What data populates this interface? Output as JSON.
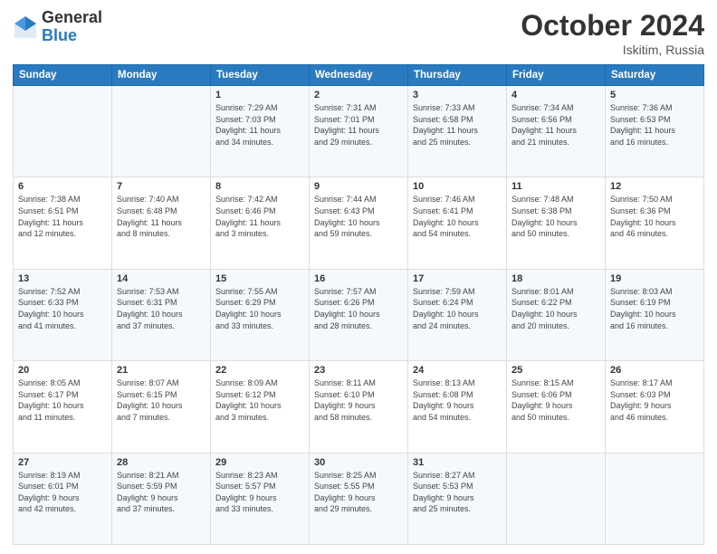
{
  "header": {
    "logo_general": "General",
    "logo_blue": "Blue",
    "title": "October 2024",
    "location": "Iskitim, Russia"
  },
  "days_of_week": [
    "Sunday",
    "Monday",
    "Tuesday",
    "Wednesday",
    "Thursday",
    "Friday",
    "Saturday"
  ],
  "weeks": [
    [
      {
        "day": "",
        "info": ""
      },
      {
        "day": "",
        "info": ""
      },
      {
        "day": "1",
        "info": "Sunrise: 7:29 AM\nSunset: 7:03 PM\nDaylight: 11 hours\nand 34 minutes."
      },
      {
        "day": "2",
        "info": "Sunrise: 7:31 AM\nSunset: 7:01 PM\nDaylight: 11 hours\nand 29 minutes."
      },
      {
        "day": "3",
        "info": "Sunrise: 7:33 AM\nSunset: 6:58 PM\nDaylight: 11 hours\nand 25 minutes."
      },
      {
        "day": "4",
        "info": "Sunrise: 7:34 AM\nSunset: 6:56 PM\nDaylight: 11 hours\nand 21 minutes."
      },
      {
        "day": "5",
        "info": "Sunrise: 7:36 AM\nSunset: 6:53 PM\nDaylight: 11 hours\nand 16 minutes."
      }
    ],
    [
      {
        "day": "6",
        "info": "Sunrise: 7:38 AM\nSunset: 6:51 PM\nDaylight: 11 hours\nand 12 minutes."
      },
      {
        "day": "7",
        "info": "Sunrise: 7:40 AM\nSunset: 6:48 PM\nDaylight: 11 hours\nand 8 minutes."
      },
      {
        "day": "8",
        "info": "Sunrise: 7:42 AM\nSunset: 6:46 PM\nDaylight: 11 hours\nand 3 minutes."
      },
      {
        "day": "9",
        "info": "Sunrise: 7:44 AM\nSunset: 6:43 PM\nDaylight: 10 hours\nand 59 minutes."
      },
      {
        "day": "10",
        "info": "Sunrise: 7:46 AM\nSunset: 6:41 PM\nDaylight: 10 hours\nand 54 minutes."
      },
      {
        "day": "11",
        "info": "Sunrise: 7:48 AM\nSunset: 6:38 PM\nDaylight: 10 hours\nand 50 minutes."
      },
      {
        "day": "12",
        "info": "Sunrise: 7:50 AM\nSunset: 6:36 PM\nDaylight: 10 hours\nand 46 minutes."
      }
    ],
    [
      {
        "day": "13",
        "info": "Sunrise: 7:52 AM\nSunset: 6:33 PM\nDaylight: 10 hours\nand 41 minutes."
      },
      {
        "day": "14",
        "info": "Sunrise: 7:53 AM\nSunset: 6:31 PM\nDaylight: 10 hours\nand 37 minutes."
      },
      {
        "day": "15",
        "info": "Sunrise: 7:55 AM\nSunset: 6:29 PM\nDaylight: 10 hours\nand 33 minutes."
      },
      {
        "day": "16",
        "info": "Sunrise: 7:57 AM\nSunset: 6:26 PM\nDaylight: 10 hours\nand 28 minutes."
      },
      {
        "day": "17",
        "info": "Sunrise: 7:59 AM\nSunset: 6:24 PM\nDaylight: 10 hours\nand 24 minutes."
      },
      {
        "day": "18",
        "info": "Sunrise: 8:01 AM\nSunset: 6:22 PM\nDaylight: 10 hours\nand 20 minutes."
      },
      {
        "day": "19",
        "info": "Sunrise: 8:03 AM\nSunset: 6:19 PM\nDaylight: 10 hours\nand 16 minutes."
      }
    ],
    [
      {
        "day": "20",
        "info": "Sunrise: 8:05 AM\nSunset: 6:17 PM\nDaylight: 10 hours\nand 11 minutes."
      },
      {
        "day": "21",
        "info": "Sunrise: 8:07 AM\nSunset: 6:15 PM\nDaylight: 10 hours\nand 7 minutes."
      },
      {
        "day": "22",
        "info": "Sunrise: 8:09 AM\nSunset: 6:12 PM\nDaylight: 10 hours\nand 3 minutes."
      },
      {
        "day": "23",
        "info": "Sunrise: 8:11 AM\nSunset: 6:10 PM\nDaylight: 9 hours\nand 58 minutes."
      },
      {
        "day": "24",
        "info": "Sunrise: 8:13 AM\nSunset: 6:08 PM\nDaylight: 9 hours\nand 54 minutes."
      },
      {
        "day": "25",
        "info": "Sunrise: 8:15 AM\nSunset: 6:06 PM\nDaylight: 9 hours\nand 50 minutes."
      },
      {
        "day": "26",
        "info": "Sunrise: 8:17 AM\nSunset: 6:03 PM\nDaylight: 9 hours\nand 46 minutes."
      }
    ],
    [
      {
        "day": "27",
        "info": "Sunrise: 8:19 AM\nSunset: 6:01 PM\nDaylight: 9 hours\nand 42 minutes."
      },
      {
        "day": "28",
        "info": "Sunrise: 8:21 AM\nSunset: 5:59 PM\nDaylight: 9 hours\nand 37 minutes."
      },
      {
        "day": "29",
        "info": "Sunrise: 8:23 AM\nSunset: 5:57 PM\nDaylight: 9 hours\nand 33 minutes."
      },
      {
        "day": "30",
        "info": "Sunrise: 8:25 AM\nSunset: 5:55 PM\nDaylight: 9 hours\nand 29 minutes."
      },
      {
        "day": "31",
        "info": "Sunrise: 8:27 AM\nSunset: 5:53 PM\nDaylight: 9 hours\nand 25 minutes."
      },
      {
        "day": "",
        "info": ""
      },
      {
        "day": "",
        "info": ""
      }
    ]
  ]
}
